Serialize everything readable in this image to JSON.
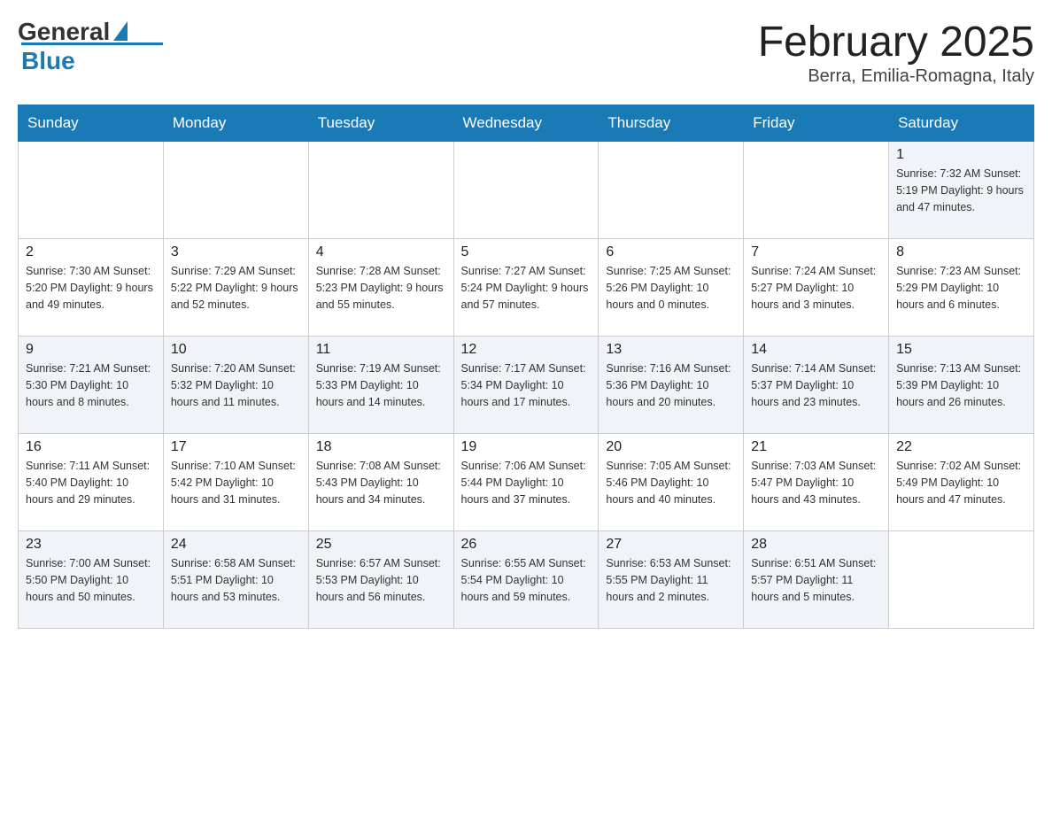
{
  "logo": {
    "general": "General",
    "blue": "Blue"
  },
  "title": {
    "month_year": "February 2025",
    "location": "Berra, Emilia-Romagna, Italy"
  },
  "headers": [
    "Sunday",
    "Monday",
    "Tuesday",
    "Wednesday",
    "Thursday",
    "Friday",
    "Saturday"
  ],
  "weeks": [
    {
      "row_class": "week-row-light",
      "days": [
        {
          "number": "",
          "info": ""
        },
        {
          "number": "",
          "info": ""
        },
        {
          "number": "",
          "info": ""
        },
        {
          "number": "",
          "info": ""
        },
        {
          "number": "",
          "info": ""
        },
        {
          "number": "",
          "info": ""
        },
        {
          "number": "1",
          "info": "Sunrise: 7:32 AM\nSunset: 5:19 PM\nDaylight: 9 hours and 47 minutes."
        }
      ]
    },
    {
      "row_class": "week-row-gray",
      "days": [
        {
          "number": "2",
          "info": "Sunrise: 7:30 AM\nSunset: 5:20 PM\nDaylight: 9 hours and 49 minutes."
        },
        {
          "number": "3",
          "info": "Sunrise: 7:29 AM\nSunset: 5:22 PM\nDaylight: 9 hours and 52 minutes."
        },
        {
          "number": "4",
          "info": "Sunrise: 7:28 AM\nSunset: 5:23 PM\nDaylight: 9 hours and 55 minutes."
        },
        {
          "number": "5",
          "info": "Sunrise: 7:27 AM\nSunset: 5:24 PM\nDaylight: 9 hours and 57 minutes."
        },
        {
          "number": "6",
          "info": "Sunrise: 7:25 AM\nSunset: 5:26 PM\nDaylight: 10 hours and 0 minutes."
        },
        {
          "number": "7",
          "info": "Sunrise: 7:24 AM\nSunset: 5:27 PM\nDaylight: 10 hours and 3 minutes."
        },
        {
          "number": "8",
          "info": "Sunrise: 7:23 AM\nSunset: 5:29 PM\nDaylight: 10 hours and 6 minutes."
        }
      ]
    },
    {
      "row_class": "week-row-light",
      "days": [
        {
          "number": "9",
          "info": "Sunrise: 7:21 AM\nSunset: 5:30 PM\nDaylight: 10 hours and 8 minutes."
        },
        {
          "number": "10",
          "info": "Sunrise: 7:20 AM\nSunset: 5:32 PM\nDaylight: 10 hours and 11 minutes."
        },
        {
          "number": "11",
          "info": "Sunrise: 7:19 AM\nSunset: 5:33 PM\nDaylight: 10 hours and 14 minutes."
        },
        {
          "number": "12",
          "info": "Sunrise: 7:17 AM\nSunset: 5:34 PM\nDaylight: 10 hours and 17 minutes."
        },
        {
          "number": "13",
          "info": "Sunrise: 7:16 AM\nSunset: 5:36 PM\nDaylight: 10 hours and 20 minutes."
        },
        {
          "number": "14",
          "info": "Sunrise: 7:14 AM\nSunset: 5:37 PM\nDaylight: 10 hours and 23 minutes."
        },
        {
          "number": "15",
          "info": "Sunrise: 7:13 AM\nSunset: 5:39 PM\nDaylight: 10 hours and 26 minutes."
        }
      ]
    },
    {
      "row_class": "week-row-gray",
      "days": [
        {
          "number": "16",
          "info": "Sunrise: 7:11 AM\nSunset: 5:40 PM\nDaylight: 10 hours and 29 minutes."
        },
        {
          "number": "17",
          "info": "Sunrise: 7:10 AM\nSunset: 5:42 PM\nDaylight: 10 hours and 31 minutes."
        },
        {
          "number": "18",
          "info": "Sunrise: 7:08 AM\nSunset: 5:43 PM\nDaylight: 10 hours and 34 minutes."
        },
        {
          "number": "19",
          "info": "Sunrise: 7:06 AM\nSunset: 5:44 PM\nDaylight: 10 hours and 37 minutes."
        },
        {
          "number": "20",
          "info": "Sunrise: 7:05 AM\nSunset: 5:46 PM\nDaylight: 10 hours and 40 minutes."
        },
        {
          "number": "21",
          "info": "Sunrise: 7:03 AM\nSunset: 5:47 PM\nDaylight: 10 hours and 43 minutes."
        },
        {
          "number": "22",
          "info": "Sunrise: 7:02 AM\nSunset: 5:49 PM\nDaylight: 10 hours and 47 minutes."
        }
      ]
    },
    {
      "row_class": "week-row-light",
      "days": [
        {
          "number": "23",
          "info": "Sunrise: 7:00 AM\nSunset: 5:50 PM\nDaylight: 10 hours and 50 minutes."
        },
        {
          "number": "24",
          "info": "Sunrise: 6:58 AM\nSunset: 5:51 PM\nDaylight: 10 hours and 53 minutes."
        },
        {
          "number": "25",
          "info": "Sunrise: 6:57 AM\nSunset: 5:53 PM\nDaylight: 10 hours and 56 minutes."
        },
        {
          "number": "26",
          "info": "Sunrise: 6:55 AM\nSunset: 5:54 PM\nDaylight: 10 hours and 59 minutes."
        },
        {
          "number": "27",
          "info": "Sunrise: 6:53 AM\nSunset: 5:55 PM\nDaylight: 11 hours and 2 minutes."
        },
        {
          "number": "28",
          "info": "Sunrise: 6:51 AM\nSunset: 5:57 PM\nDaylight: 11 hours and 5 minutes."
        },
        {
          "number": "",
          "info": ""
        }
      ]
    }
  ]
}
